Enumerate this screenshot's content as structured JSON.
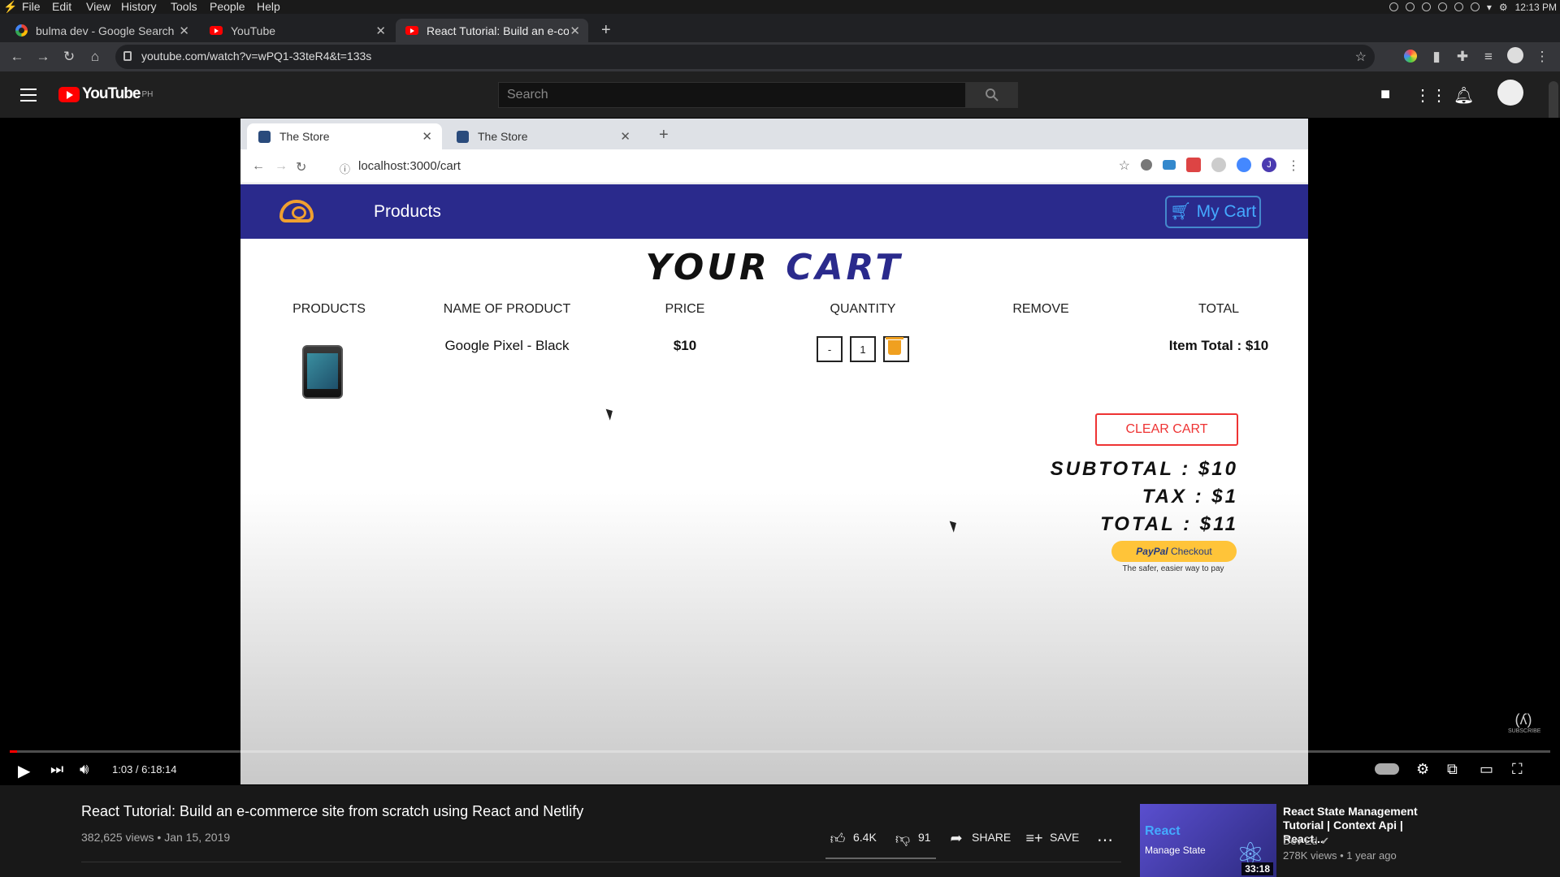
{
  "os_menu": {
    "items": [
      "File",
      "Edit",
      "View",
      "History",
      "Tools",
      "People",
      "Help"
    ],
    "clock": "12:13 PM"
  },
  "browser": {
    "tabs": [
      {
        "title": "bulma dev - Google Search",
        "favicon": "google-icon"
      },
      {
        "title": "YouTube",
        "favicon": "youtube-icon"
      },
      {
        "title": "React Tutorial: Build an e-com",
        "favicon": "youtube-icon"
      }
    ],
    "url": "youtube.com/watch?v=wPQ1-33teR4&t=133s"
  },
  "youtube": {
    "region": "PH",
    "logo_text": "YouTube",
    "search_placeholder": "Search"
  },
  "video_frame": {
    "tabs": [
      "The Store",
      "The Store"
    ],
    "url": "localhost:3000/cart",
    "profile_letter": "J",
    "nav": {
      "products": "Products",
      "cart": "My Cart"
    },
    "cart_title_a": "YOUR",
    "cart_title_b": "CART",
    "columns": [
      "PRODUCTS",
      "NAME OF PRODUCT",
      "PRICE",
      "QUANTITY",
      "REMOVE",
      "TOTAL"
    ],
    "item": {
      "name": "Google Pixel - Black",
      "price": "$10",
      "quantity": "1",
      "dec": "-",
      "inc": "+",
      "item_total": "Item Total : $10"
    },
    "clear_cart": "CLEAR CART",
    "subtotal": "SUBTOTAL : $10",
    "tax": "TAX : $1",
    "total": "TOTAL : $11",
    "paypal_brand": "PayPal",
    "paypal_label": "Checkout",
    "paypal_note": "The safer, easier way to pay"
  },
  "player": {
    "time": "1:03 / 6:18:14",
    "progress_fraction": 0.003,
    "watermark": "SUBSCRIBE"
  },
  "video": {
    "title": "React Tutorial: Build an e-commerce site from scratch using React and Netlify",
    "views": "382,625 views",
    "date": "Jan 15, 2019",
    "likes": "6.4K",
    "dislikes": "91",
    "share": "SHARE",
    "save": "SAVE"
  },
  "related": {
    "title": "React State Management Tutorial | Context Api | React...",
    "channel": "Dev Ed",
    "meta": "278K views • 1 year ago",
    "thumb_line1": "React",
    "thumb_line2": "Manage State",
    "duration": "33:18"
  }
}
